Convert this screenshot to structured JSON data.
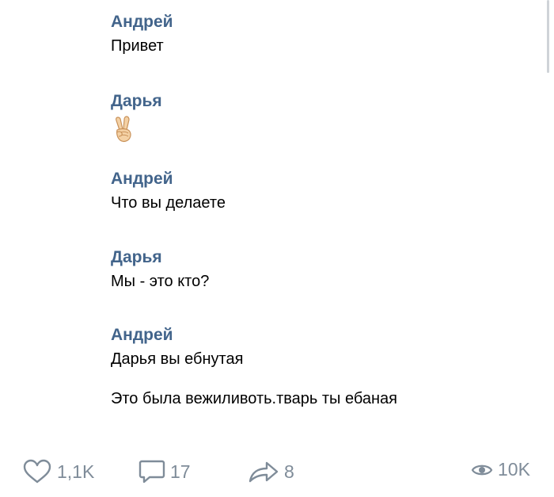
{
  "messages": [
    {
      "author": "Андрей",
      "text": "Привет"
    },
    {
      "author": "Дарья",
      "emoji": "victory-hand-emoji"
    },
    {
      "author": "Андрей",
      "text": "Что вы делаете"
    },
    {
      "author": "Дарья",
      "text": "Мы - это кто?"
    },
    {
      "author": "Андрей",
      "text": "Дарья вы ебнутая",
      "text2": "Это была вежиливоть.тварь ты ебаная"
    }
  ],
  "actions": {
    "likes": "1,1K",
    "comments": "17",
    "shares": "8",
    "views": "10K"
  },
  "colors": {
    "author": "#42648b",
    "icon": "#7f8c99"
  }
}
